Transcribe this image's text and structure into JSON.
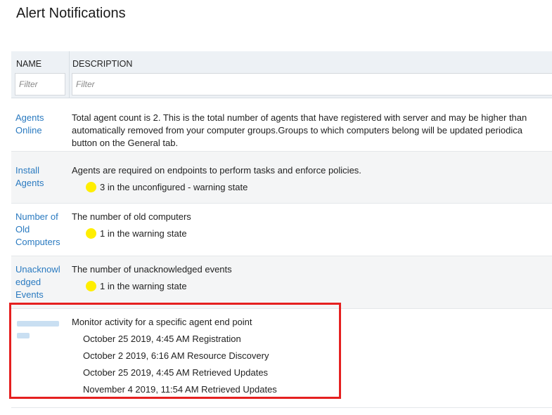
{
  "page_title": "Alert Notifications",
  "table": {
    "columns": {
      "name": "NAME",
      "description": "DESCRIPTION"
    },
    "filters": {
      "name_placeholder": "Filter",
      "description_placeholder": "Filter"
    },
    "rows": [
      {
        "name": "Agents Online",
        "description_lines": [
          "Total agent count is 2. This is the total number of agents that have registered with server and may be higher than",
          "automatically removed from your computer groups.Groups to which computers belong will be updated periodica",
          "button on the General tab."
        ]
      },
      {
        "name": "Install Agents",
        "description": "Agents are required on endpoints to perform tasks and enforce policies.",
        "status": "3 in the unconfigured - warning state",
        "status_color": "#ffee00"
      },
      {
        "name_lines": [
          "Number of",
          "Old",
          "Computers"
        ],
        "description": "The number of old computers",
        "status": "1 in the warning state",
        "status_color": "#ffee00"
      },
      {
        "name_lines": [
          "Unacknowl",
          "edged",
          "Events"
        ],
        "description": "The number of unacknowledged events",
        "status": "1 in the warning state",
        "status_color": "#ffee00"
      },
      {
        "description": "Monitor activity for a specific agent end point",
        "events": [
          "October 25 2019, 4:45 AM Registration",
          "October 2 2019, 6:16 AM Resource Discovery",
          "October 25 2019, 4:45 AM Retrieved Updates",
          "November 4 2019, 11:54 AM Retrieved Updates"
        ]
      }
    ]
  },
  "colors": {
    "link": "#2a7ac0",
    "warning": "#ffee00",
    "highlight_border": "#e52020",
    "header_bg": "#edf1f5"
  }
}
